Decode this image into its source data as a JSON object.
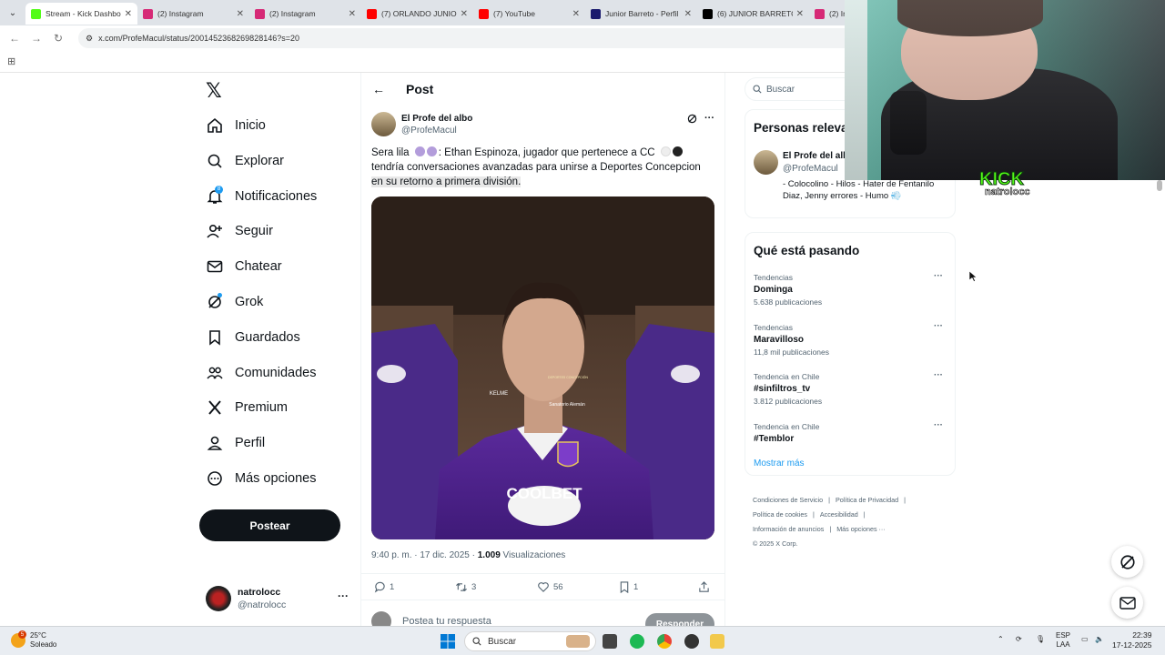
{
  "browser": {
    "tabs": [
      {
        "title": "Stream - Kick Dashboard",
        "color": "#53fc18",
        "active": true
      },
      {
        "title": "(2) Instagram",
        "color": "#d62976",
        "active": false
      },
      {
        "title": "(2) Instagram",
        "color": "#d62976",
        "active": false
      },
      {
        "title": "(7) ORLANDO JUNIOR",
        "color": "#ff0000",
        "active": false
      },
      {
        "title": "(7) YouTube",
        "color": "#ff0000",
        "active": false
      },
      {
        "title": "Junior Barreto - Perfil",
        "color": "#1a1a6e",
        "active": false
      },
      {
        "title": "(6) JUNIOR BARRETO",
        "color": "#000000",
        "active": false
      },
      {
        "title": "(2) In",
        "color": "#d62976",
        "active": false
      }
    ],
    "url": "x.com/ProfeMacul/status/2001452368269828146?s=20"
  },
  "nav": {
    "items": [
      {
        "label": "Inicio",
        "icon": "home-icon"
      },
      {
        "label": "Explorar",
        "icon": "search-icon"
      },
      {
        "label": "Notificaciones",
        "icon": "bell-icon",
        "badge": "8"
      },
      {
        "label": "Seguir",
        "icon": "follow-icon"
      },
      {
        "label": "Chatear",
        "icon": "mail-icon"
      },
      {
        "label": "Grok",
        "icon": "grok-icon"
      },
      {
        "label": "Guardados",
        "icon": "bookmark-icon"
      },
      {
        "label": "Comunidades",
        "icon": "communities-icon"
      },
      {
        "label": "Premium",
        "icon": "x-icon"
      },
      {
        "label": "Perfil",
        "icon": "profile-icon"
      },
      {
        "label": "Más opciones",
        "icon": "more-icon"
      }
    ],
    "post_button": "Postear",
    "account": {
      "name": "natrolocc",
      "handle": "@natrolocc"
    }
  },
  "post": {
    "header_title": "Post",
    "author_name": "El Profe del albo",
    "author_handle": "@ProfeMacul",
    "text_a": "Sera lila",
    "text_b": ": Ethan Espinoza, jugador que pertenece a CC",
    "text_c": "tendría conversaciones avanzadas para unirse a Deportes Concepcion",
    "text_highlight": "en su retorno a primera división.",
    "timestamp": "9:40 p. m. · 17 dic. 2025 ·",
    "views_count": "1.009",
    "views_label": "Visualizaciones",
    "replies": "1",
    "reposts": "3",
    "likes": "56",
    "bookmarks": "1",
    "reply_placeholder": "Postea tu respuesta",
    "reply_button": "Responder",
    "image_text": {
      "sponsor": "COOLBET",
      "kit_brand": "KELME",
      "sponsor2": "Sanatorio Alemán",
      "crest": "DEPORTES CONCEPCIÓN"
    }
  },
  "sidebar": {
    "search_placeholder": "Buscar",
    "relevant_title": "Personas relevantes",
    "person": {
      "name": "El Profe del albo",
      "handle": "@ProfeMacul",
      "bio": "- Colocolino - Hilos - Hater de Fentanilo Diaz, Jenny errores - Humo"
    },
    "trends_title": "Qué está pasando",
    "trends": [
      {
        "context": "Tendencias",
        "name": "Dominga",
        "count": "5.638 publicaciones"
      },
      {
        "context": "Tendencias",
        "name": "Maravilloso",
        "count": "11,8 mil publicaciones"
      },
      {
        "context": "Tendencia en Chile",
        "name": "#sinfiltros_tv",
        "count": "3.812 publicaciones"
      },
      {
        "context": "Tendencia en Chile",
        "name": "#Temblor",
        "count": ""
      }
    ],
    "show_more": "Mostrar más",
    "footer_links": [
      "Condiciones de Servicio",
      "Política de Privacidad",
      "Política de cookies",
      "Accesibilidad",
      "Información de anuncios",
      "Más opciones ···"
    ],
    "copyright": "© 2025 X Corp."
  },
  "overlay": {
    "kick_logo": "KICK",
    "kick_user": "natrolocc"
  },
  "taskbar": {
    "temp": "25°C",
    "weather": "Soleado",
    "weather_badge": "5",
    "search_label": "Buscar",
    "lang_top": "ESP",
    "lang_bottom": "LAA",
    "time": "22:39",
    "date": "17-12-2025"
  }
}
